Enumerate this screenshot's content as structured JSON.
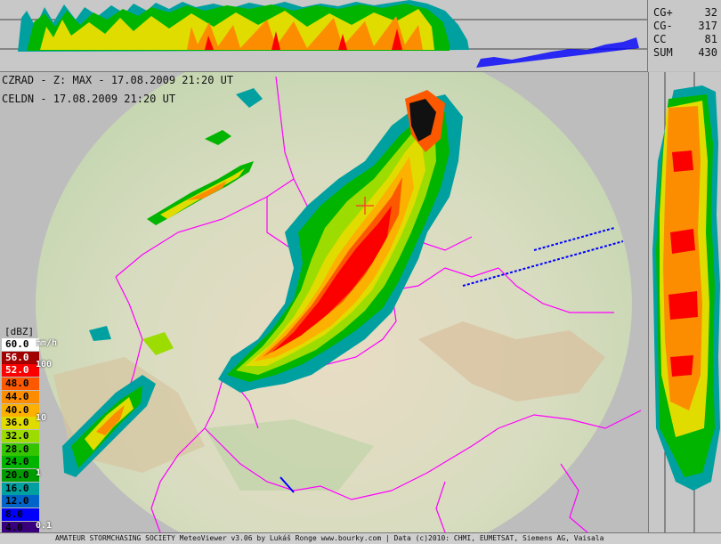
{
  "header": {
    "product_line": "CZRAD - Z: MAX - 17.08.2009 21:20 UT",
    "lightning_line": "CELDN - 17.08.2009 21:20 UT"
  },
  "lightning_stats": [
    {
      "label": "CG+",
      "value": "32"
    },
    {
      "label": "CG-",
      "value": "317"
    },
    {
      "label": "CC",
      "value": "81"
    },
    {
      "label": "SUM",
      "value": "430"
    }
  ],
  "legend": {
    "title": "[dBZ]",
    "rate_unit": "mm/h",
    "rows": [
      {
        "label": "60.0",
        "color": "#ffffff",
        "text_color": "#000000"
      },
      {
        "label": "56.0",
        "color": "#a00000",
        "text_color": "#ffffff"
      },
      {
        "label": "52.0",
        "color": "#fc0000",
        "text_color": "#ffffff"
      },
      {
        "label": "48.0",
        "color": "#fc5800",
        "text_color": "#000000"
      },
      {
        "label": "44.0",
        "color": "#fc8c00",
        "text_color": "#000000"
      },
      {
        "label": "40.0",
        "color": "#fcb000",
        "text_color": "#000000"
      },
      {
        "label": "36.0",
        "color": "#e0dc00",
        "text_color": "#000000"
      },
      {
        "label": "32.0",
        "color": "#9cdc00",
        "text_color": "#000000"
      },
      {
        "label": "28.0",
        "color": "#34c400",
        "text_color": "#000000"
      },
      {
        "label": "24.0",
        "color": "#00b400",
        "text_color": "#000000"
      },
      {
        "label": "20.0",
        "color": "#009c00",
        "text_color": "#000000"
      },
      {
        "label": "16.0",
        "color": "#00a0a0",
        "text_color": "#000000"
      },
      {
        "label": "12.0",
        "color": "#0064c8",
        "text_color": "#000000"
      },
      {
        "label": "8.0",
        "color": "#0000fc",
        "text_color": "#000000"
      },
      {
        "label": "4.0",
        "color": "#38007c",
        "text_color": "#000000"
      }
    ],
    "rate_labels": [
      "100",
      "10",
      "1",
      "0.1"
    ]
  },
  "footer": {
    "credit": "AMATEUR STORMCHASING SOCIETY MeteoViewer v3.06 by Lukáš Ronge www.bourky.com | Data (c)2010: CHMI, EUMETSAT, Siemens AG, Vaisala"
  },
  "colors": {
    "border_line": "#ff00ff",
    "background": "#bdbdbd",
    "accent_red_cross": "#ff3030"
  }
}
